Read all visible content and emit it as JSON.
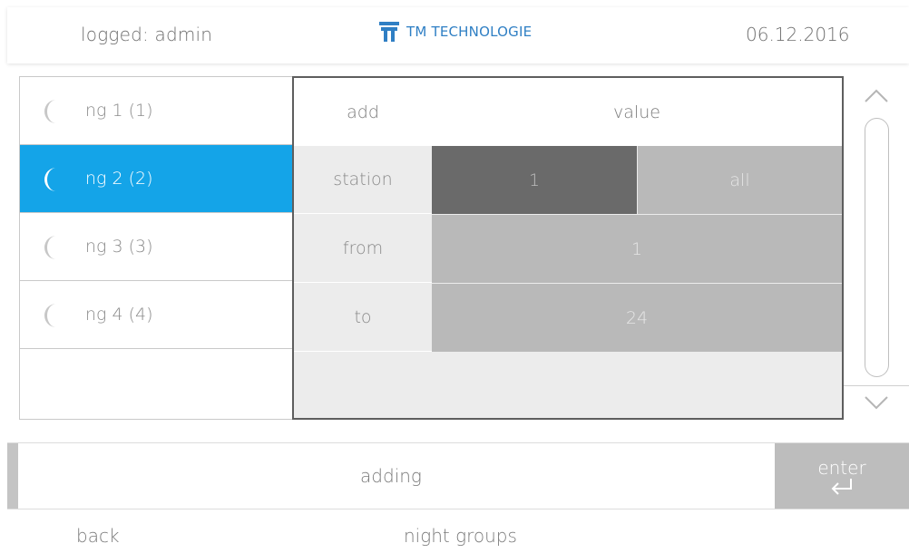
{
  "header": {
    "logged_text": "logged: admin",
    "logo_text": "TM TECHNOLOGIE",
    "logo_icon": "tm-logo-icon",
    "date": "06.12.2016"
  },
  "night_groups": [
    {
      "label": "ng 1 (1)",
      "icon": "moon-icon",
      "selected": false
    },
    {
      "label": "ng 2 (2)",
      "icon": "moon-icon",
      "selected": true
    },
    {
      "label": "ng 3 (3)",
      "icon": "moon-icon",
      "selected": false
    },
    {
      "label": "ng 4 (4)",
      "icon": "moon-icon",
      "selected": false
    }
  ],
  "panel": {
    "col_add": "add",
    "col_value": "value",
    "station": {
      "label": "station",
      "option_one": "1",
      "option_all": "all",
      "selected": "1"
    },
    "from": {
      "label": "from",
      "value": "1"
    },
    "to": {
      "label": "to",
      "value": "24"
    }
  },
  "bottom_bar": {
    "title": "adding",
    "enter_label": "enter"
  },
  "footer": {
    "back_label": "back",
    "screen_title": "night groups"
  },
  "colors": {
    "accent": "#14a4e8",
    "logo": "#2f7fc4",
    "cell_light": "#b9b9b9",
    "cell_dark": "#6a6a6a",
    "panel_bg": "#ececec"
  }
}
